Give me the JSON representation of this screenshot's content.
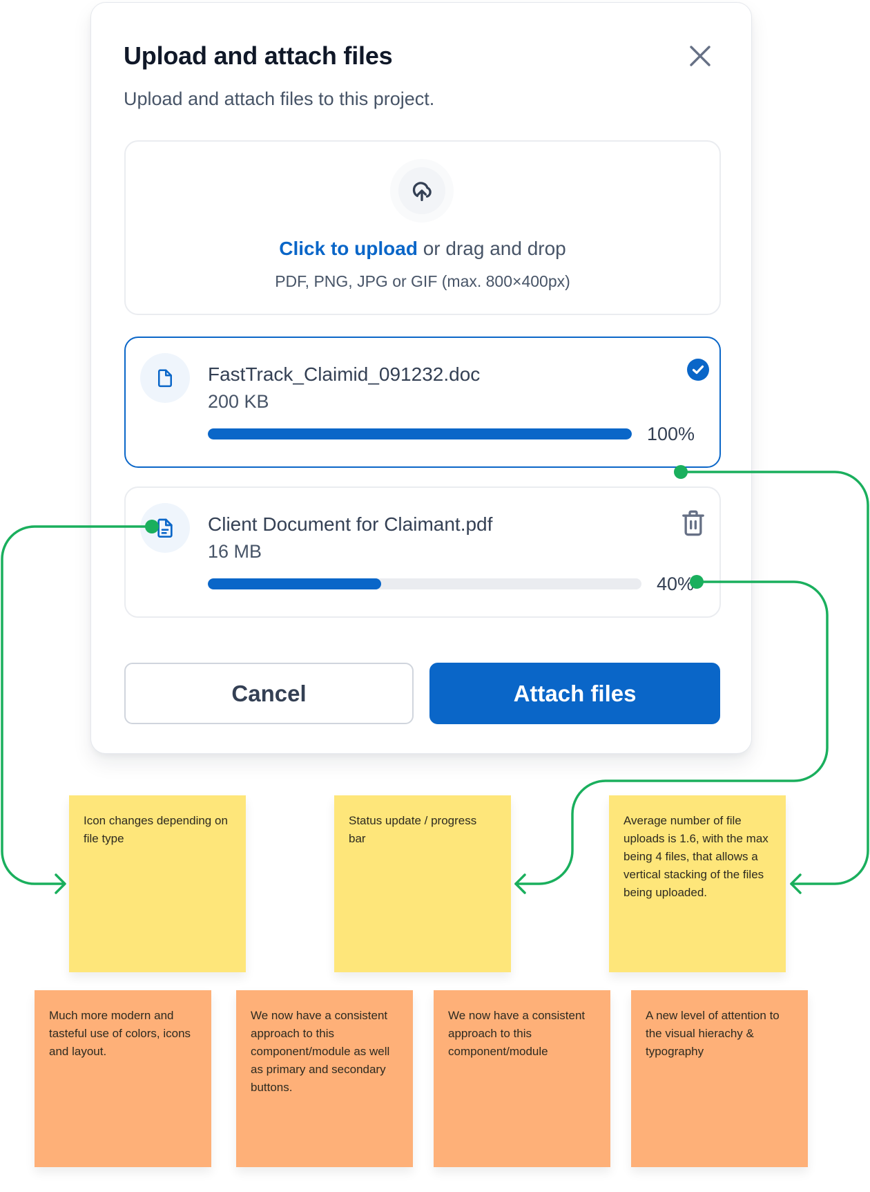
{
  "dialog": {
    "title": "Upload and attach files",
    "subtitle": "Upload and attach files to this project.",
    "close_icon": "x-close-icon"
  },
  "dropzone": {
    "icon": "cloud-upload-icon",
    "link_label": "Click to upload",
    "trailing_text": " or drag and drop",
    "hint": "PDF, PNG, JPG or GIF (max. 800×400px)"
  },
  "files": [
    {
      "name": "FastTrack_Claimid_091232.doc",
      "size": "200 KB",
      "progress_percent": 100,
      "progress_label": "100%",
      "icon": "file-icon",
      "status_icon": "check-circle-icon",
      "state": "complete"
    },
    {
      "name": "Client Document for Claimant.pdf",
      "size": "16 MB",
      "progress_percent": 40,
      "progress_label": "40%",
      "icon": "file-text-icon",
      "action_icon": "trash-icon",
      "state": "uploading"
    }
  ],
  "actions": {
    "cancel_label": "Cancel",
    "attach_label": "Attach files"
  },
  "colors": {
    "primary": "#0a66c8",
    "connector": "#1aaf5d",
    "note_yellow": "#fee67a",
    "note_orange": "#feb078"
  },
  "annotations": {
    "yellow": [
      "Icon changes depending on file type",
      "Status update / progress bar",
      "Average number of file uploads is 1.6, with the max being 4 files, that allows a vertical stacking of the files being uploaded."
    ],
    "orange": [
      "Much more modern and tasteful use of colors, icons and layout.",
      "We now have a consistent approach to this component/module as well as primary and secondary buttons.",
      "We now have a consistent approach to this component/module",
      "A new level of attention to the visual hierachy & typography"
    ]
  }
}
